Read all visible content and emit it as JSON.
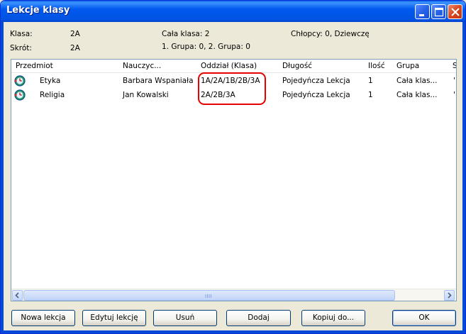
{
  "window": {
    "title": "Lekcje klasy"
  },
  "info": {
    "klasa_label": "Klasa:",
    "klasa_value": "2A",
    "skrot_label": "Skrót:",
    "skrot_value": "2A",
    "cala_klasa": "Cała klasa: 2",
    "grupy": "1. Grupa: 0, 2. Grupa: 0",
    "chlopcy": "Chłopcy: 0, Dziewczęta"
  },
  "list": {
    "columns": [
      "Przedmiot",
      "Nauczyc...",
      "Oddział (Klasa)",
      "Długość",
      "Ilość",
      "Grupa",
      "S"
    ],
    "rows": [
      {
        "przedmiot": "Etyka",
        "nauczyciel": "Barbara Wspaniała",
        "oddzial": "1A/2A/1B/2B/3A",
        "dlugosc": "Pojedyńcza Lekcja",
        "ilosc": "1",
        "grupa": "Cała klas...",
        "s": "'",
        "icon": "lesson-clock-icon"
      },
      {
        "przedmiot": "Religia",
        "nauczyciel": "Jan Kowalski",
        "oddzial": "2A/2B/3A",
        "dlugosc": "Pojedyńcza Lekcja",
        "ilosc": "1",
        "grupa": "Cała klas...",
        "s": "'",
        "icon": "lesson-clock-icon"
      }
    ]
  },
  "buttons": {
    "nowa": "Nowa lekcja",
    "edytuj": "Edytuj lekcję",
    "usun": "Usuń",
    "dodaj": "Dodaj",
    "kopiuj": "Kopiuj do...",
    "ok": "OK"
  },
  "colors": {
    "highlight": "#e60000",
    "titlebar": "#0054e3",
    "window_bg": "#ece9d8"
  }
}
